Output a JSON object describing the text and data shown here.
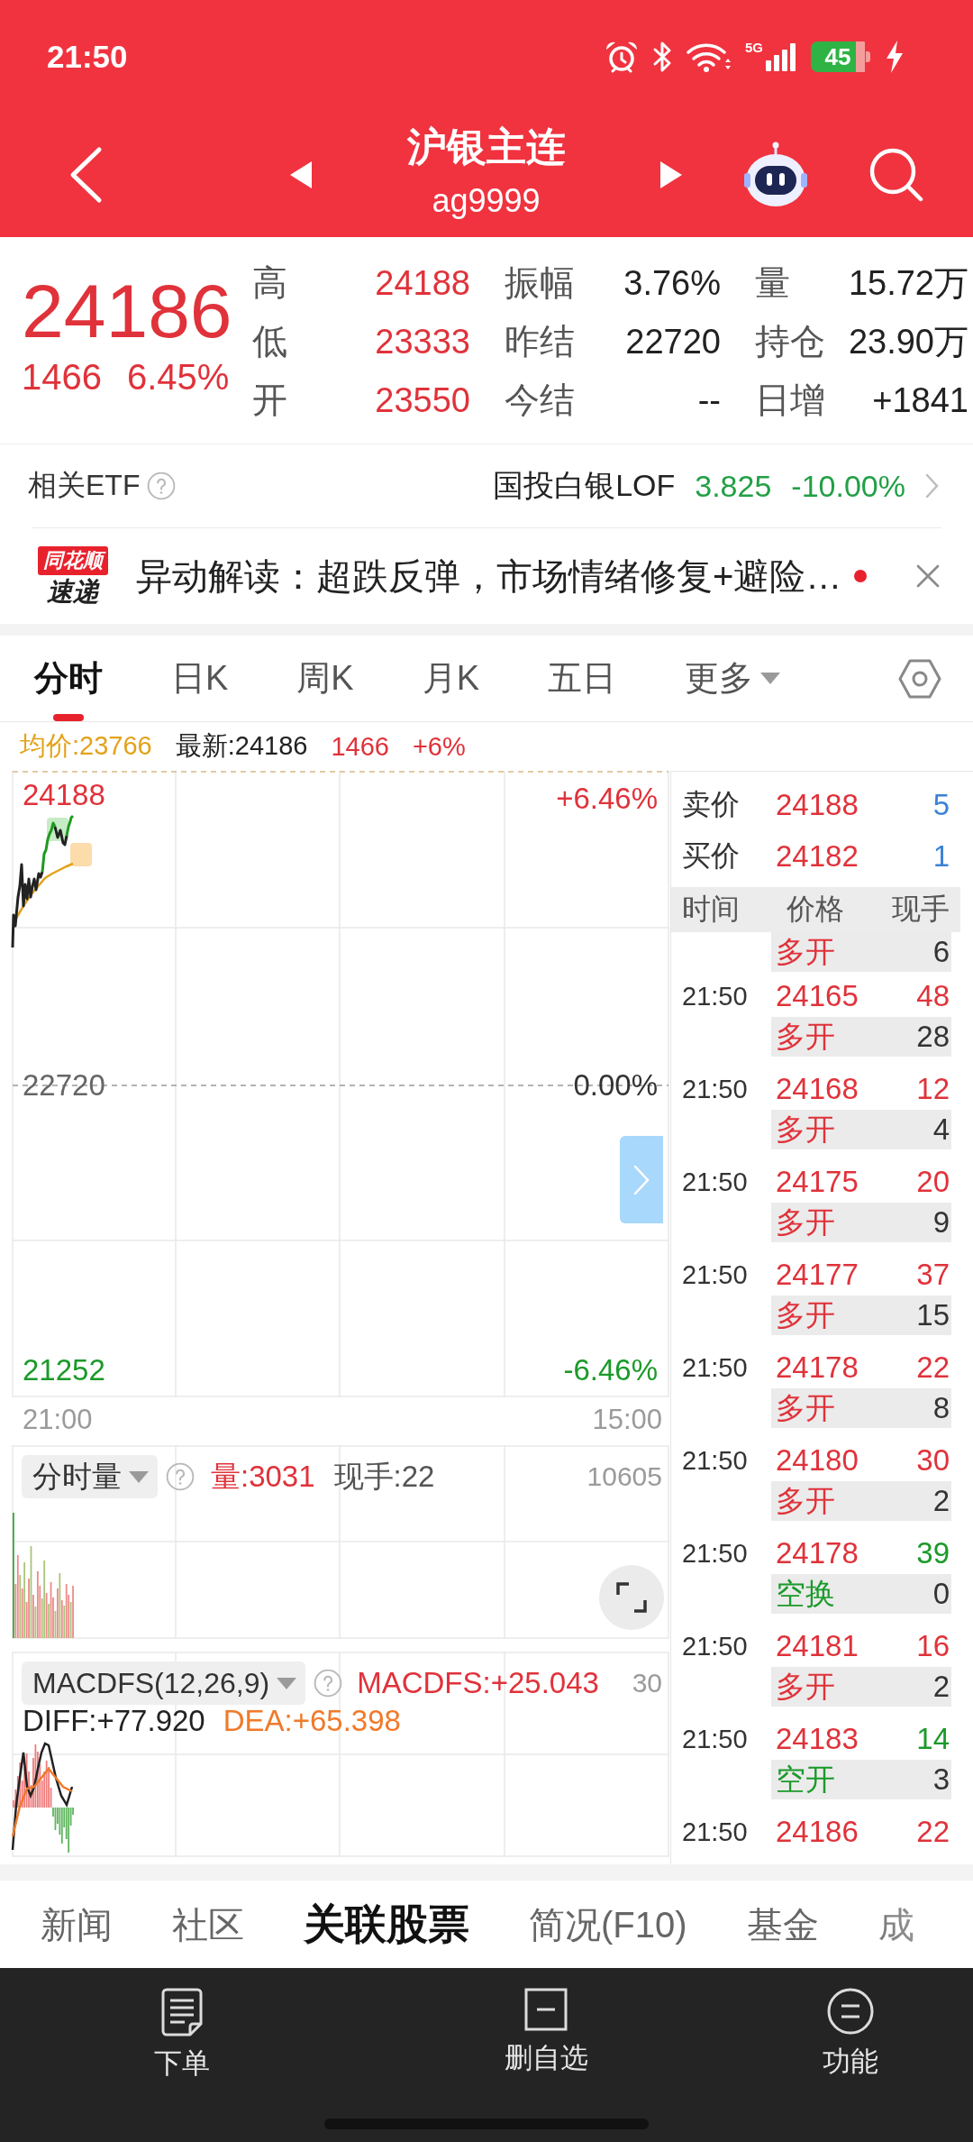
{
  "status_bar": {
    "time": "21:50",
    "network": "5G",
    "battery": "45",
    "charging": true
  },
  "nav": {
    "title": "沪银主连",
    "code": "ag9999"
  },
  "quote": {
    "price": "24186",
    "change": "1466",
    "change_pct": "6.45%",
    "stat_rows": [
      {
        "cells": [
          {
            "label": "高",
            "value": "24188",
            "color": "#e0323a"
          },
          {
            "label": "振幅",
            "value": "3.76%",
            "color": "#222222"
          },
          {
            "label": "量",
            "value": "15.72万",
            "color": "#222222"
          }
        ]
      },
      {
        "cells": [
          {
            "label": "低",
            "value": "23333",
            "color": "#e0323a"
          },
          {
            "label": "昨结",
            "value": "22720",
            "color": "#222222"
          },
          {
            "label": "持仓",
            "value": "23.90万",
            "color": "#222222"
          }
        ]
      },
      {
        "cells": [
          {
            "label": "开",
            "value": "23550",
            "color": "#e0323a"
          },
          {
            "label": "今结",
            "value": "--",
            "color": "#222222"
          },
          {
            "label": "日增",
            "value": "+1841",
            "color": "#222222"
          }
        ]
      }
    ]
  },
  "etf": {
    "label": "相关ETF",
    "name": "国投白银LOF",
    "price": "3.825",
    "change": "-10.00%"
  },
  "news": {
    "logo_top": "同花顺",
    "logo_bottom": "速递",
    "text": "异动解读：超跌反弹，市场情绪修复+避险…",
    "unread": true
  },
  "chart_tabs": [
    {
      "label": "分时",
      "selected": true,
      "kind": "tab"
    },
    {
      "label": "日K",
      "selected": false,
      "kind": "tab"
    },
    {
      "label": "周K",
      "selected": false,
      "kind": "tab"
    },
    {
      "label": "月K",
      "selected": false,
      "kind": "tab"
    },
    {
      "label": "五日",
      "selected": false,
      "kind": "tab"
    },
    {
      "label": "更多",
      "selected": false,
      "kind": "menu"
    }
  ],
  "chart_info": {
    "average": "均价:23766",
    "latest": "最新:24186",
    "change": "1466",
    "change_pct": "+6%"
  },
  "price_chart": {
    "top_price": "24188",
    "top_pct": "+6.46%",
    "mid_price": "22720",
    "mid_pct": "0.00%",
    "bottom_price": "21252",
    "bottom_pct": "-6.46%",
    "start_time": "21:00",
    "end_time": "15:00"
  },
  "volume_panel": {
    "indicator": "分时量",
    "volume": "量:3031",
    "last_hand": "现手:22",
    "scale_max": "10605"
  },
  "macd_panel": {
    "indicator": "MACDFS(12,26,9)",
    "macdfs": "MACDFS:+25.043",
    "scale_max": "30",
    "diff": "DIFF:+77.920",
    "dea": "DEA:+65.398"
  },
  "quotes_panel": {
    "book": [
      {
        "label": "卖价",
        "price": "24188",
        "volume": "5"
      },
      {
        "label": "买价",
        "price": "24182",
        "volume": "1"
      }
    ],
    "columns": [
      "时间",
      "价格",
      "现手"
    ],
    "trades": [
      {
        "kind": "lower",
        "action": "多开",
        "hand": "6",
        "color": "#e0323a"
      },
      {
        "kind": "full",
        "time": "21:50",
        "price": "24165",
        "volume": "48",
        "action": "多开",
        "hand": "28",
        "color": "#e0323a"
      },
      {
        "kind": "full",
        "time": "21:50",
        "price": "24168",
        "volume": "12",
        "action": "多开",
        "hand": "4",
        "color": "#e0323a"
      },
      {
        "kind": "full",
        "time": "21:50",
        "price": "24175",
        "volume": "20",
        "action": "多开",
        "hand": "9",
        "color": "#e0323a"
      },
      {
        "kind": "full",
        "time": "21:50",
        "price": "24177",
        "volume": "37",
        "action": "多开",
        "hand": "15",
        "color": "#e0323a"
      },
      {
        "kind": "full",
        "time": "21:50",
        "price": "24178",
        "volume": "22",
        "action": "多开",
        "hand": "8",
        "color": "#e0323a"
      },
      {
        "kind": "full",
        "time": "21:50",
        "price": "24180",
        "volume": "30",
        "action": "多开",
        "hand": "2",
        "color": "#e0323a"
      },
      {
        "kind": "full",
        "time": "21:50",
        "price": "24178",
        "volume": "39",
        "action": "空换",
        "hand": "0",
        "color": "#1b9a2a"
      },
      {
        "kind": "full",
        "time": "21:50",
        "price": "24181",
        "volume": "16",
        "action": "多开",
        "hand": "2",
        "color": "#e0323a"
      },
      {
        "kind": "full",
        "time": "21:50",
        "price": "24183",
        "volume": "14",
        "action": "空开",
        "hand": "3",
        "color": "#1b9a2a"
      },
      {
        "kind": "upper",
        "time": "21:50",
        "price": "24186",
        "volume": "22",
        "color": "#e0323a"
      }
    ]
  },
  "bottom_tabs": [
    {
      "label": "新闻",
      "selected": false
    },
    {
      "label": "社区",
      "selected": false
    },
    {
      "label": "关联股票",
      "selected": true
    },
    {
      "label": "简况(F10)",
      "selected": false
    },
    {
      "label": "基金",
      "selected": false
    },
    {
      "label": "成",
      "selected": false
    }
  ],
  "bottom_nav": [
    {
      "label": "下单",
      "kind": "order"
    },
    {
      "label": "删自选",
      "kind": "remove"
    },
    {
      "label": "功能",
      "kind": "menu"
    }
  ]
}
